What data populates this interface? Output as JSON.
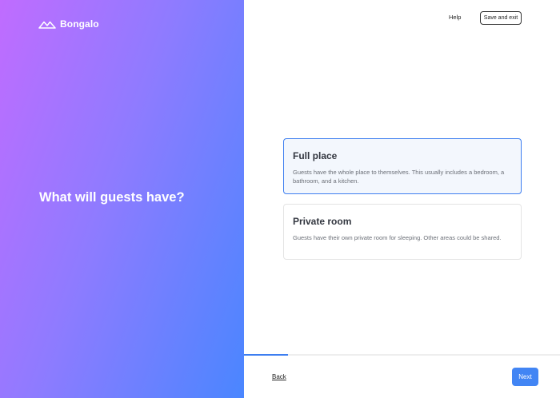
{
  "brand": {
    "name": "Bongalo",
    "logo_icon": "mountains-logo-icon"
  },
  "left": {
    "headline": "What will guests have?"
  },
  "header": {
    "help_label": "Help",
    "save_exit_label": "Save and exit"
  },
  "options": [
    {
      "title": "Full place",
      "description": "Guests have the whole place to themselves. This usually includes a bedroom, a bathroom, and a kitchen.",
      "selected": true
    },
    {
      "title": "Private room",
      "description": "Guests have their own private room for sleeping. Other areas could be shared.",
      "selected": false
    }
  ],
  "progress": {
    "fraction": 0.14
  },
  "footer": {
    "back_label": "Back",
    "next_label": "Next"
  },
  "colors": {
    "accent": "#4285f4",
    "selected_border": "#3d7ef0",
    "gradient_start": "#c06cff",
    "gradient_end": "#4a86ff"
  }
}
